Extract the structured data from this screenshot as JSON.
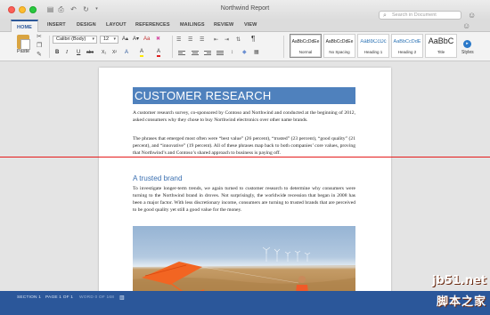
{
  "window": {
    "title": "Northwind Report"
  },
  "search": {
    "placeholder": "Search in Document"
  },
  "tabs": [
    "HOME",
    "INSERT",
    "DESIGN",
    "LAYOUT",
    "REFERENCES",
    "MAILINGS",
    "REVIEW",
    "VIEW"
  ],
  "ribbon": {
    "paste_label": "Paste",
    "font_name": "Calibri (Body)",
    "font_size": "12",
    "grow_label": "A▴",
    "shrink_label": "A▾",
    "bold": "B",
    "italic": "I",
    "underline": "U",
    "strike": "abc",
    "subscript": "X₂",
    "superscript": "X²",
    "highlight": "A",
    "font_color": "A",
    "pilcrow": "¶",
    "styles_pane_label": "Styles"
  },
  "styles_gallery": [
    {
      "sample": "AaBbCcDdEe",
      "name": "Normal"
    },
    {
      "sample": "AaBbCcDdEe",
      "name": "No Spacing"
    },
    {
      "sample": "AaBbCcDc",
      "name": "Heading 1"
    },
    {
      "sample": "AaBbCcDdE",
      "name": "Heading 2"
    },
    {
      "sample": "AaBbC",
      "name": "Title"
    }
  ],
  "document": {
    "title": "CUSTOMER RESEARCH",
    "paragraphs": [
      "A customer research survey, co-sponsored by Contoso and Northwind and conducted at the beginning of 2012, asked consumers why they chose to buy Northwind electronics over other name brands.",
      "The phrases that emerged most often were “best value” (26 percent), “trusted” (23 percent), “good quality” (21 percent), and “innovative” (19 percent). All of these phrases map back to both companies’ core values, proving that Northwind’s and Contoso’s shared approach to business is paying off."
    ],
    "heading": "A trusted brand",
    "paragraph3": "To investigate longer-term trends, we again turned to customer research to determine why consumers were turning to the Northwind brand in droves. Not surprisingly, the worldwide recession that began in 2008 has been a major factor. With less discretionary income, consumers are turning to trusted brands that are perceived to be good quality yet still a good value for the money."
  },
  "status": {
    "section": "SECTION 1",
    "page": "PAGE 1 OF 1",
    "words": "WORD 0 OF 168"
  },
  "watermark": {
    "line1": "jb51.net",
    "line2": "脚本之家"
  },
  "colors": {
    "accent": "#2b579a",
    "title_fill": "#4f81bd",
    "heading_text": "#3a6fb0",
    "marker_line": "#e51b1b"
  }
}
